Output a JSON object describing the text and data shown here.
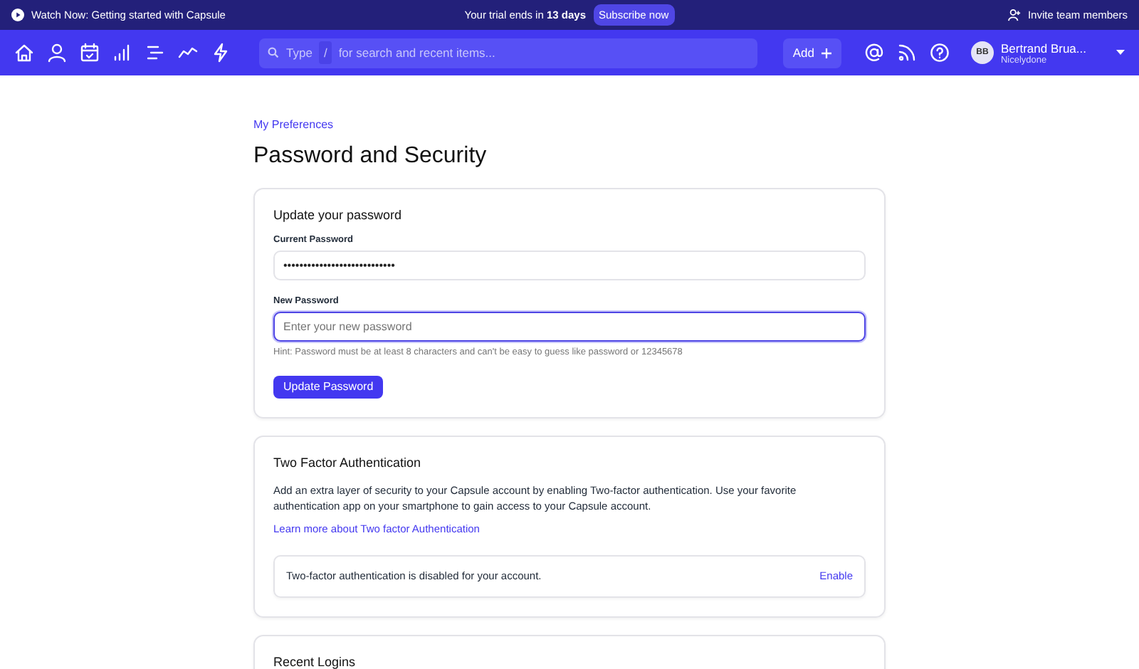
{
  "banner": {
    "video_link": "Watch Now: Getting started with Capsule",
    "trial": "Your trial ends in **13 days**",
    "subscribe": "Subscribe now",
    "invite": "Invite team members"
  },
  "nav": {
    "search": {
      "prefix": "Type",
      "shortcut": "/",
      "placeholder": "for search and recent items..."
    },
    "add": "Add",
    "user": {
      "initials": "BB",
      "name": "Bertrand Brua...",
      "company": "Nicelydone"
    }
  },
  "breadcrumb": "My Preferences",
  "title": "Password and Security",
  "password_card": {
    "heading": "Update your password",
    "fields": [
      {
        "label": "Current Password",
        "value": "••••••••••••••••••••••••••••",
        "focused": false
      },
      {
        "label": "New Password",
        "placeholder": "Enter your new password",
        "focused": true
      }
    ],
    "hint": "Hint: Password must be at least 8 characters and can't be easy to guess like password or 12345678",
    "button": "Update Password"
  },
  "two_factor_card": {
    "heading": "Two Factor Authentication",
    "description": "Add an extra layer of security to your Capsule account by enabling Two-factor authentication. Use your favorite authentication app on your smartphone to gain access to your Capsule account.",
    "link": "Learn more about Two factor Authentication",
    "status": "Two-factor authentication is disabled for your account.",
    "action": "Enable"
  },
  "logins_card": {
    "heading": "Recent Logins"
  }
}
